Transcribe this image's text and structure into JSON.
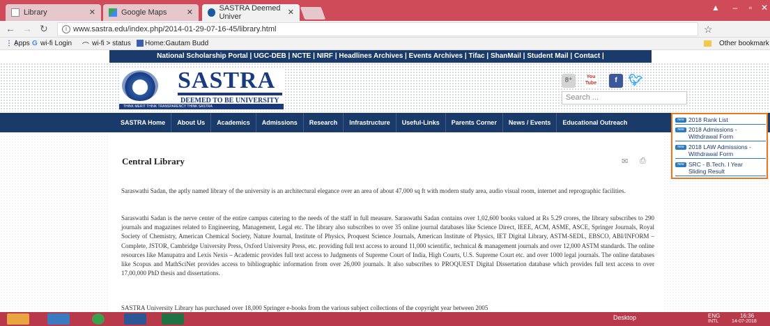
{
  "browser": {
    "tabs": [
      {
        "label": "Library",
        "active": false
      },
      {
        "label": "Google Maps",
        "active": false
      },
      {
        "label": "SASTRA Deemed Univer",
        "active": true
      }
    ],
    "url": "www.sastra.edu/index.php/2014-01-29-07-16-45/library.html",
    "bookmarks": [
      "Apps",
      "wi-fi Login",
      "wi-fi > status",
      "Home:Gautam Budd"
    ],
    "other_bookmarks": "Other bookmark"
  },
  "site": {
    "top_links": "National Scholarship Portal | UGC-DEB | NCTE | NIRF | Headlines Archives | Events Archives | Tifac | ShanMail | Student Mail | Contact |",
    "logo": {
      "name": "SASTRA",
      "subtitle": "DEEMED TO BE UNIVERSITY",
      "tagline": "THINK MERIT  THINK TRANSPARENCY  THINK SASTRA"
    },
    "social": [
      "g+",
      "You Tube",
      "f",
      "twitter"
    ],
    "search_placeholder": "Search ...",
    "main_nav": [
      "SASTRA Home",
      "About Us",
      "Academics",
      "Admissions",
      "Research",
      "Infrastructure",
      "Useful-Links",
      "Parents Corner",
      "News / Events",
      "Educational Outreach"
    ],
    "news": [
      {
        "badge": "new",
        "text": "2018 Rank List"
      },
      {
        "badge": "new",
        "text": "2018 Admissions - Withdrawal Form"
      },
      {
        "badge": "new",
        "text": "2018 LAW Admissions - Withdrawal Form"
      },
      {
        "badge": "new",
        "text": "SRC - B.Tech. I Year Sliding Result"
      }
    ]
  },
  "article": {
    "title": "Central Library",
    "paragraphs": [
      "Saraswathi Sadan, the aptly named library of the university is an architectural elegance over an area of about 47,000 sq ft with modern study area, audio visual room, internet and reprographic facilities.",
      "Saraswathi Sadan is the nerve center of the entire campus catering to the needs of the staff in full measure. Saraswathi Sadan contains over 1,02,600 books valued at Rs 5.29 crores, the library subscribes to 290 journals and magazines related to Engineering, Management, Legal etc. The library also subscribes to over 35 online journal databases like Science Direct, IEEE, ACM, ASME, ASCE, Springer Journals, Royal Society of Chemistry, American Chemical Society, Nature Journal, Institute of Physics, Proquest Science Journals, American Institute of Physics, IET Digital Library, ASTM-SEDL, EBSCO, ABI/INFORM – Complete, JSTOR, Cambridge University Press, Oxford University Press, etc. providing full text access to around 11,000 scientific, technical & management journals and over 12,000 ASTM standards. The online resources like Manupatra and Lexis Nexis – Academic provides full text access to Judgments of Supreme Court of India, High Courts, U.S. Supreme Court etc. and over 1000 legal journals. The online databases like Scopus and MathSciNet provides access to bibliographic information from over 26,000 journals. It also subscribes to PROQUEST Digital Dissertation database which provides full text access to over 17,00,000 PhD thesis and dissertations.",
      "SASTRA University Library has purchased over 18,000 Springer e-books from the various subject collections of the copyright year between 2005"
    ]
  },
  "taskbar": {
    "desktop_label": "Desktop",
    "lang": "ENG",
    "lang_sub": "INTL",
    "time": "16:36",
    "date": "14-07-2018"
  },
  "colors": {
    "chrome_red": "#d04b5a",
    "nav_blue": "#1a3a6a",
    "news_border": "#e8771e",
    "taskbar": "#b83a4a"
  }
}
